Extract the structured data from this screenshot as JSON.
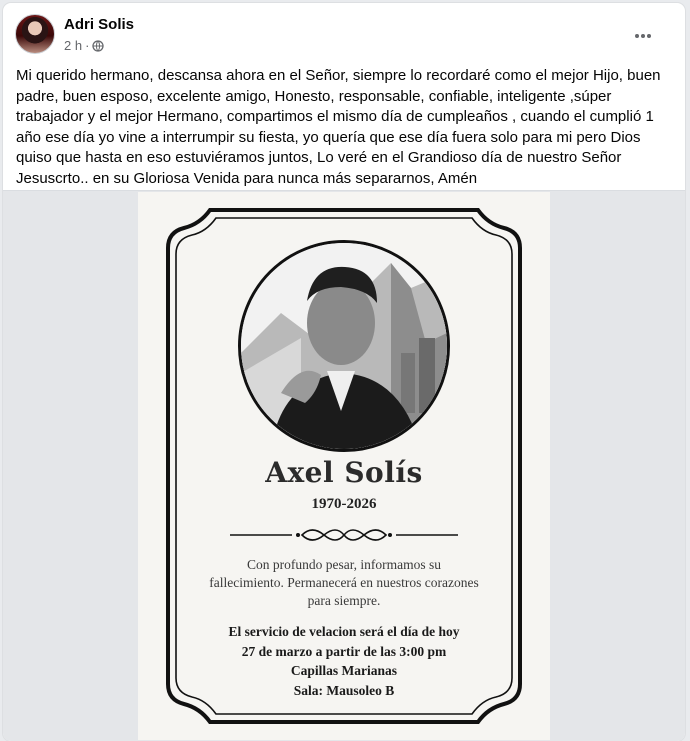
{
  "post": {
    "author": "Adri Solis",
    "time": "2 h",
    "separator": "·",
    "privacy_icon": "globe-icon",
    "more_icon": "more-options-icon",
    "text": "Mi querido hermano, descansa ahora en el Señor, siempre lo recordaré como el mejor Hijo, buen padre, buen esposo, excelente amigo, Honesto, responsable, confiable, inteligente ,súper trabajador y el mejor Hermano, compartimos el mismo día de cumpleaños , cuando el cumplió 1 año ese día yo vine a interrumpir su fiesta, yo quería que ese día fuera solo para mi pero Dios quiso que hasta en eso estuviéramos juntos, Lo veré en el Grandioso día de nuestro Señor Jesuscrto.. en su Gloriosa Venida para nunca más separarnos, Amén"
  },
  "memorial": {
    "name": "Axel Solís",
    "years": "1970-2026",
    "message": "Con profundo pesar, informamos su fallecimiento. Permanecerá en nuestros corazones para siempre.",
    "service_lines": [
      "El servicio de velacion será el día de hoy",
      "27 de marzo a partir de las 3:00 pm",
      "Capillas Marianas",
      "Sala: Mausoleo B"
    ]
  },
  "colors": {
    "text_primary": "#050505",
    "text_secondary": "#65676b",
    "card_background": "#ffffff",
    "feed_background": "#e9ebee"
  }
}
